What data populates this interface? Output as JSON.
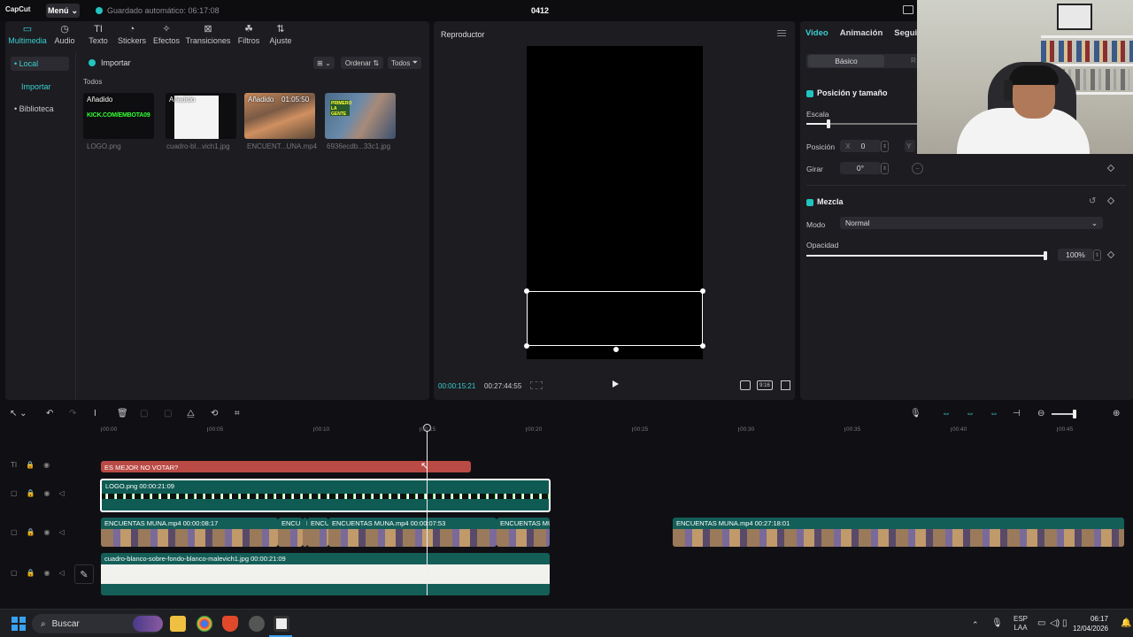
{
  "titlebar": {
    "logo": "CapCut",
    "menu_label": "Menú",
    "autosave": "Guardado automático: 06:17:08",
    "project_title": "0412"
  },
  "media_toolbar": {
    "tabs": [
      {
        "label": "Multimedia",
        "glyph": "▭",
        "icon": "media-icon"
      },
      {
        "label": "Audio",
        "glyph": "◷",
        "icon": "audio-icon"
      },
      {
        "label": "Texto",
        "glyph": "TI",
        "icon": "text-icon"
      },
      {
        "label": "Stickers",
        "glyph": "◔",
        "icon": "sticker-icon"
      },
      {
        "label": "Efectos",
        "glyph": "✧",
        "icon": "effects-icon"
      },
      {
        "label": "Transiciones",
        "glyph": "⊠",
        "icon": "transitions-icon"
      },
      {
        "label": "Filtros",
        "glyph": "☘",
        "icon": "filters-icon"
      },
      {
        "label": "Ajuste",
        "glyph": "⇅",
        "icon": "adjust-icon"
      }
    ]
  },
  "media_side": {
    "local": "• Local",
    "importar": "Importar",
    "biblioteca": "• Biblioteca"
  },
  "media": {
    "import_label": "Importar",
    "sort_label": "Ordenar",
    "filter_label": "Todos",
    "section_label": "Todos",
    "items": [
      {
        "badge": "Añadido",
        "name": "LOGO.png",
        "overlay": "KICK.COM/EMBOTA09"
      },
      {
        "badge": "Añadido",
        "name": "cuadro-bl...vich1.jpg"
      },
      {
        "badge": "Añadido",
        "duration": "01:05:50",
        "name": "ENCUENT...UNA.mp4"
      },
      {
        "badge": "",
        "name": "6936ecdb...33c1.jpg",
        "overlay": "PRIMERO LA GENTE"
      }
    ]
  },
  "player": {
    "title": "Reproductor",
    "current_time": "00:00:15:21",
    "total_time": "00:27:44:55",
    "ratio_label": "9:16"
  },
  "inspector": {
    "tabs": [
      "Video",
      "Animación",
      "Segui"
    ],
    "subtab_basic": "Básico",
    "subtab_other": "R",
    "pos_size_title": "Posición y tamaño",
    "scale_label": "Escala",
    "scale_value": 0.2,
    "position_label": "Posición",
    "position_x_label": "X",
    "position_x_value": "0",
    "position_y_label": "Y",
    "rotate_label": "Girar",
    "rotate_value": "0°",
    "blend_title": "Mezcla",
    "mode_label": "Modo",
    "mode_value": "Normal",
    "opacity_label": "Opacidad",
    "opacity_value": "100%",
    "opacity_fraction": 1.0
  },
  "timeline": {
    "ruler_ticks": [
      "00:00",
      "00:05",
      "00:10",
      "00:15",
      "00:20",
      "00:25",
      "00:30",
      "00:35",
      "00:40",
      "00:45"
    ],
    "text_clip": "ES MEJOR NO VOTAR?",
    "logo_clip": "LOGO.png   00:00:21:09",
    "video_clips": [
      {
        "label": "ENCUENTAS MUNA.mp4   00:00:08:17"
      },
      {
        "label": "ENCU"
      },
      {
        "label": "E"
      },
      {
        "label": "ENCU"
      },
      {
        "label": "ENCUENTAS MUNA.mp4   00:00:07:53"
      },
      {
        "label": "ENCUENTAS MU"
      },
      {
        "label": "ENCUENTAS MUNA.mp4   00:27:18:01"
      }
    ],
    "white_clip": "cuadro-blanco-sobre-fondo-blanco-malevich1.jpg   00:00:21:09"
  },
  "taskbar": {
    "search_placeholder": "Buscar",
    "lang": "ESP",
    "lang2": "LAA",
    "time": "06:17",
    "date": "12/04/2026"
  },
  "colors": {
    "accent": "#23c4c0",
    "text_clip": "#b94a45",
    "video_clip": "#145e58"
  }
}
